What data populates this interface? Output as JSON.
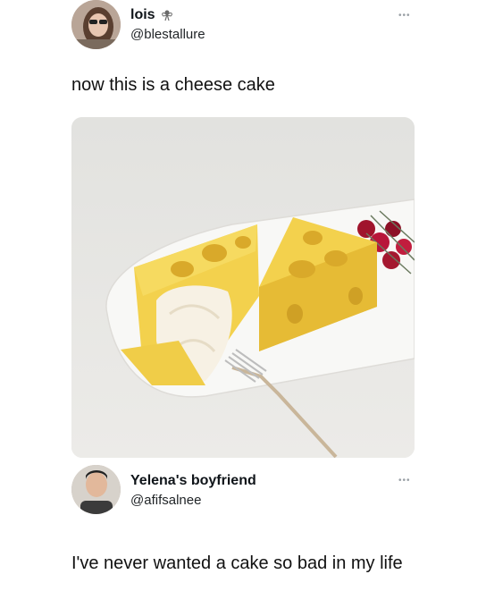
{
  "tweet1": {
    "name": "lois",
    "handle": "@blestallure",
    "text": "now this is a cheese cake",
    "more_label": "•••",
    "badge_icon": "fairy-icon",
    "media_icon": "cheese-cake-photo"
  },
  "tweet2": {
    "name": "Yelena's boyfriend",
    "handle": "@afifsalnee",
    "text": "I've never wanted a cake so bad in my life",
    "more_label": "•••"
  },
  "colors": {
    "cheese": "#f2d04a",
    "cheese_shadow": "#d9b02f",
    "plate": "#f7f7f5",
    "background": "#e6e6e3"
  }
}
